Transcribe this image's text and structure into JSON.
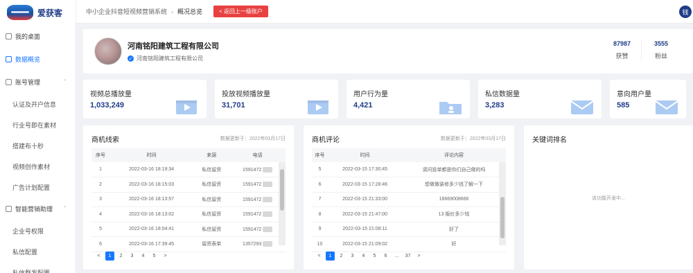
{
  "app": {
    "logo_text": "爱获客",
    "user_initial": "钱"
  },
  "sidebar": {
    "items": [
      {
        "label": "我的桌面",
        "active": false,
        "sub": false
      },
      {
        "label": "数据概览",
        "active": true,
        "sub": false
      },
      {
        "label": "账号管理",
        "active": false,
        "sub": false,
        "chevron": "ˇ"
      },
      {
        "label": "认证及开户信息",
        "sub": true
      },
      {
        "label": "行业号即在素材",
        "sub": true
      },
      {
        "label": "搭建布十秒",
        "sub": true
      },
      {
        "label": "视频创作素材",
        "sub": true
      },
      {
        "label": "广告计划配置",
        "sub": true
      },
      {
        "label": "智能营销助理",
        "active": false,
        "sub": false,
        "chevron": "ˇ"
      },
      {
        "label": "企业号权限",
        "sub": true
      },
      {
        "label": "私信配置",
        "sub": true
      },
      {
        "label": "私信群发配置",
        "sub": true
      }
    ]
  },
  "header": {
    "crumb1": "中小企业抖音短视频营销系统",
    "crumb2": "概况总览",
    "back_label": "< 返回上一级账户"
  },
  "company": {
    "name": "河南铭阳建筑工程有限公司",
    "sub": "河南铭阳建筑工程有限公司",
    "stats": [
      {
        "value": "87987",
        "label": "获赞"
      },
      {
        "value": "3555",
        "label": "粉丝"
      }
    ]
  },
  "metrics": [
    {
      "label": "视频总播放量",
      "value": "1,033,249",
      "icon": "video-icon"
    },
    {
      "label": "投放视频播放量",
      "value": "31,701",
      "icon": "video-icon"
    },
    {
      "label": "用户行为量",
      "value": "4,421",
      "icon": "folder-user-icon"
    },
    {
      "label": "私信数据量",
      "value": "3,283",
      "icon": "mail-icon"
    },
    {
      "label": "意向用户量",
      "value": "585",
      "icon": "mail-icon"
    }
  ],
  "leads_panel": {
    "title": "商机线索",
    "meta": "数据更新于：2022年03月17日",
    "headers": [
      "序号",
      "时间",
      "来源",
      "电话"
    ],
    "rows": [
      [
        "1",
        "2022-03-16 18:19:34",
        "私信留资",
        "1591472"
      ],
      [
        "2",
        "2022-03-16 18:15:03",
        "私信留资",
        "1591472"
      ],
      [
        "3",
        "2022-03-16 18:13:57",
        "私信留资",
        "1591472"
      ],
      [
        "4",
        "2022-03-16 18:13:02",
        "私信留资",
        "1591472"
      ],
      [
        "5",
        "2022-03-16 18:04:41",
        "私信留资",
        "1591472"
      ],
      [
        "6",
        "2022-03-16 17:39:45",
        "留资表单",
        "1357293"
      ]
    ],
    "pages": [
      "<",
      "1",
      "2",
      "3",
      "4",
      "5",
      ">"
    ],
    "current_page": "1"
  },
  "comments_panel": {
    "title": "商机评论",
    "meta": "数据更新于：2022年03月17日",
    "headers": [
      "序号",
      "时间",
      "评论内容"
    ],
    "rows": [
      [
        "5",
        "2022-03-15 17:30:45",
        "请问投单都是你们自己做的吗"
      ],
      [
        "6",
        "2022-03-15 17:28:46",
        "想做做装修多少钱了解一下"
      ],
      [
        "7",
        "2022-03-15 21:33:00",
        "16669008666"
      ],
      [
        "8",
        "2022-03-15 21:47:00",
        "13     报价多少钱"
      ],
      [
        "9",
        "2022-03-15 21:08:11",
        "好了"
      ],
      [
        "10",
        "2022-03-15 21:09:02",
        "好"
      ]
    ],
    "pages": [
      "<",
      "1",
      "2",
      "3",
      "4",
      "5",
      "6",
      "...",
      "37",
      ">"
    ],
    "current_page": "1"
  },
  "keywords_panel": {
    "title": "关键词排名",
    "empty_text": "该功能开发中..."
  },
  "colors": {
    "accent": "#1677ff",
    "brand": "#1f3c88",
    "back_button": "#e84141"
  }
}
